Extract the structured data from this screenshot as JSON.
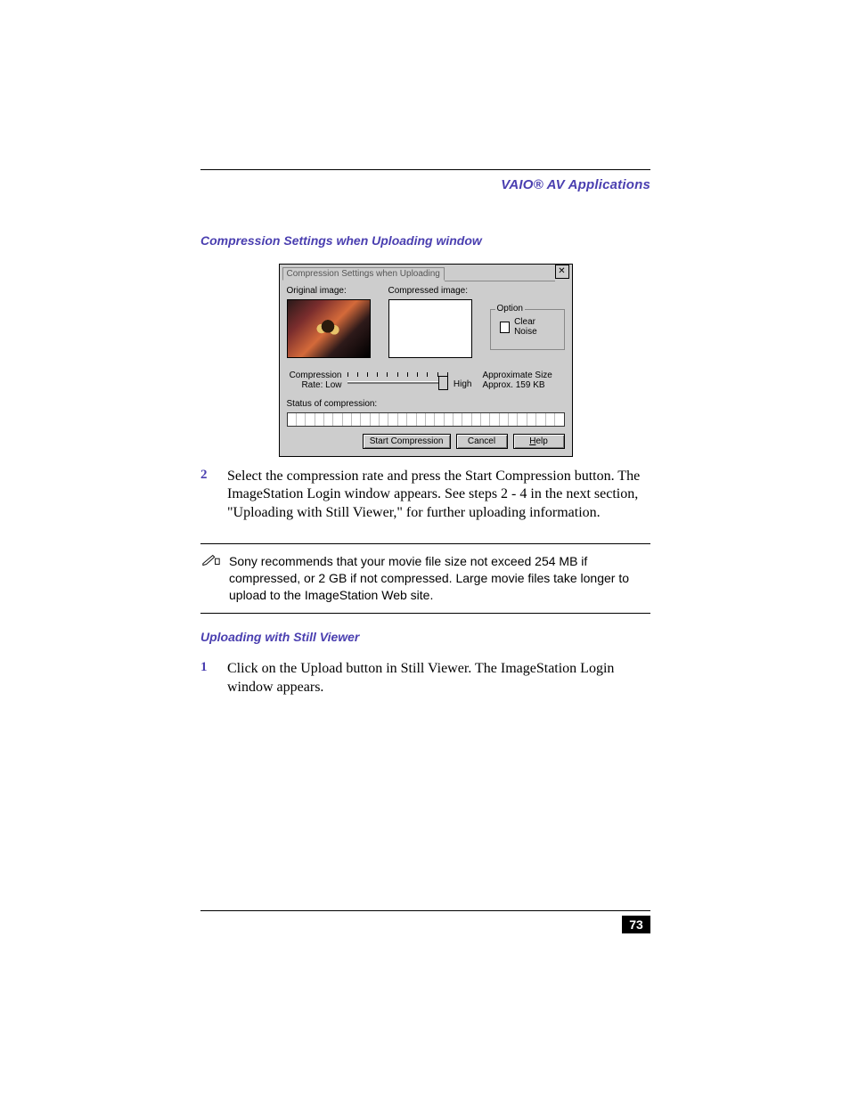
{
  "header": {
    "title": "VAIO® AV Applications"
  },
  "section1": {
    "heading": "Compression Settings when Uploading window"
  },
  "dialog": {
    "title": "Compression Settings when Uploading",
    "original_label": "Original image:",
    "compressed_label": "Compressed image:",
    "option_legend": "Option",
    "clear_noise": "Clear Noise",
    "compression_rate_label": "Compression Rate:",
    "low": "Low",
    "high": "High",
    "approx_label": "Approximate Size",
    "approx_value": "Approx.  159 KB",
    "status_label": "Status of compression:",
    "start_btn": "Start Compression",
    "cancel_btn": "Cancel",
    "help_btn": "Help"
  },
  "step2": {
    "num": "2",
    "text": "Select the compression rate and press the Start Compression button. The ImageStation Login window appears. See steps 2 - 4 in the next section, \"Uploading with Still Viewer,\" for further uploading information."
  },
  "note": {
    "text": "Sony recommends that your movie file size not exceed 254 MB if compressed, or 2 GB if not compressed. Large movie files take longer to upload to the ImageStation Web site."
  },
  "section2": {
    "heading": "Uploading with Still Viewer"
  },
  "step1b": {
    "num": "1",
    "text": "Click on the Upload button in Still Viewer. The ImageStation Login window appears."
  },
  "footer": {
    "page": "73"
  }
}
